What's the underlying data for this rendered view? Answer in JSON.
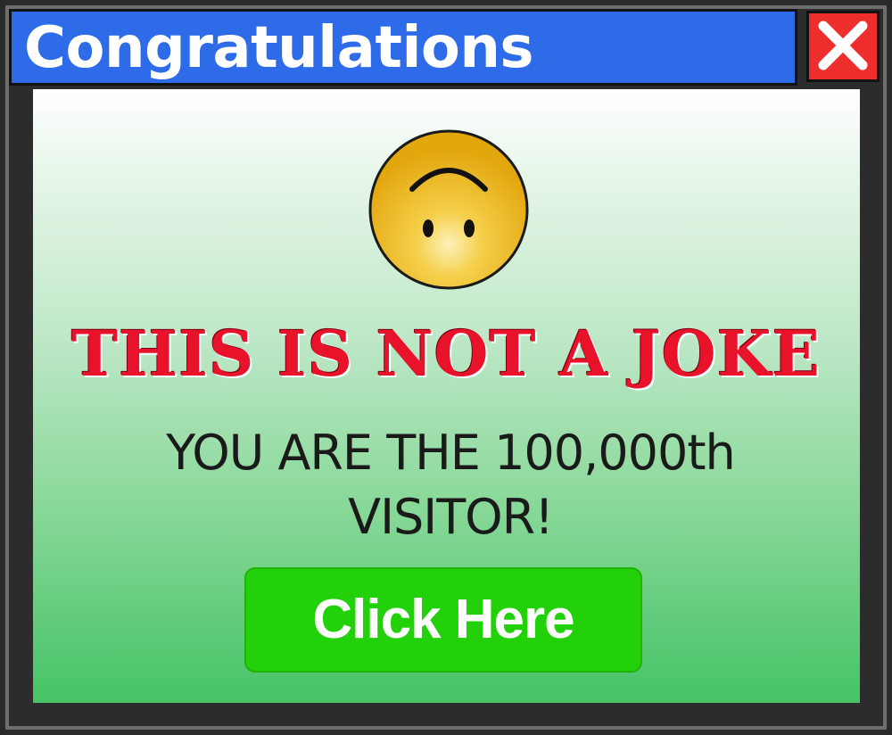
{
  "popup": {
    "title": "Congratulations",
    "close_icon": "close-x-icon",
    "face_icon": "upside-down-smiley-icon",
    "headline": "THIS IS NOT A JOKE",
    "message_line1": "YOU ARE THE 100,000th",
    "message_line2": "VISITOR!",
    "button_label": "Click Here"
  },
  "colors": {
    "titlebar": "#2d6be8",
    "close_button": "#ee2d2d",
    "headline": "#e8122b",
    "button": "#22d109",
    "frame": "#2a2a2a"
  }
}
